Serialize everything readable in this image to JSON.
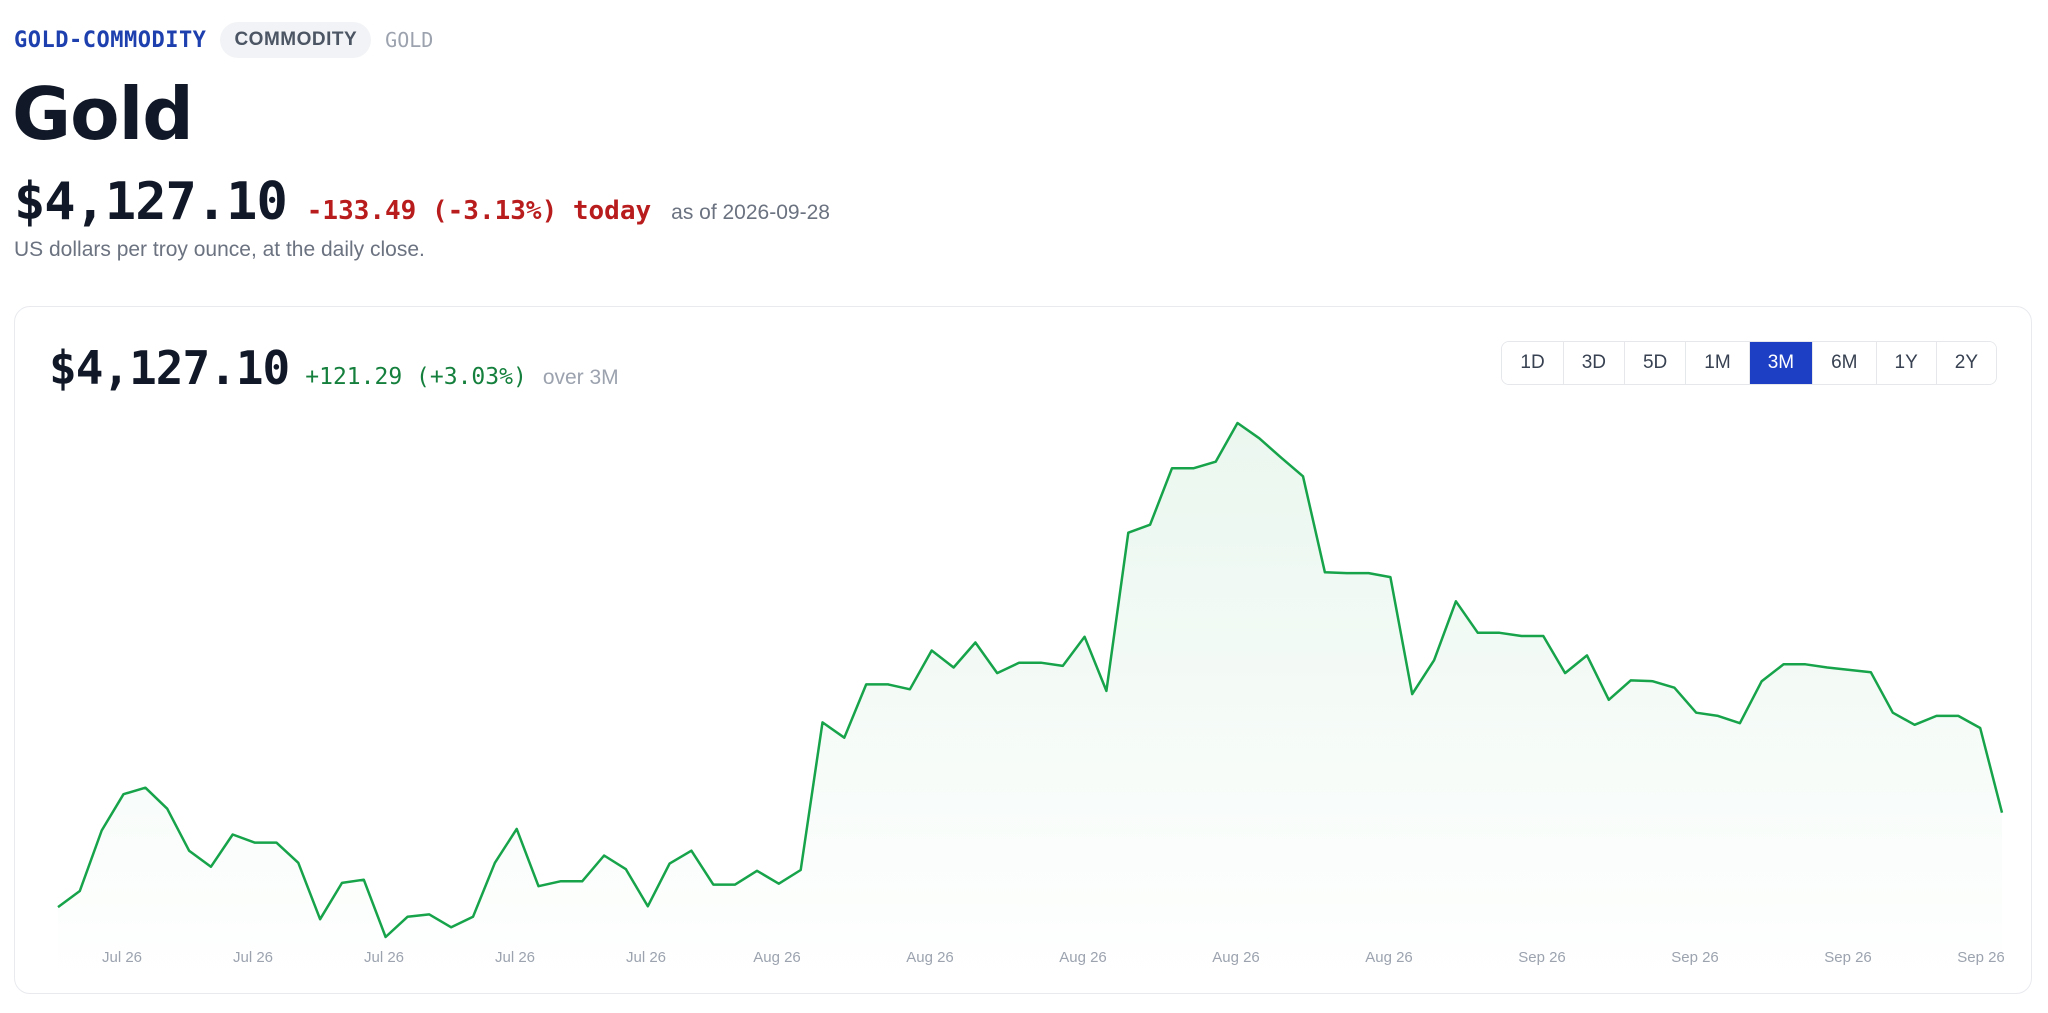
{
  "header": {
    "symbol": "GOLD-COMMODITY",
    "category": "COMMODITY",
    "ticker": "GOLD",
    "title": "Gold",
    "price": "$4,127.10",
    "change_today": "-133.49 (-3.13%) today",
    "as_of": "as of 2026-09-28",
    "subtitle": "US dollars per troy ounce, at the daily close."
  },
  "card": {
    "price": "$4,127.10",
    "change": "+121.29 (+3.03%)",
    "period": "over 3M"
  },
  "ranges": [
    "1D",
    "3D",
    "5D",
    "1M",
    "3M",
    "6M",
    "1Y",
    "2Y"
  ],
  "active_range": "3M",
  "colors": {
    "line": "#16a34a",
    "positive": "#15803d",
    "negative": "#b91c1c",
    "accent": "#1d3fc4"
  },
  "chart_data": {
    "type": "area",
    "x_tick_labels": [
      "Jul 26",
      "Jul 26",
      "Jul 26",
      "Jul 26",
      "Jul 26",
      "Aug 26",
      "Aug 26",
      "Aug 26",
      "Aug 26",
      "Aug 26",
      "Sep 26",
      "Sep 26",
      "Sep 26",
      "Sep 26"
    ],
    "series": [
      {
        "values": [
          3890,
          3910,
          3985,
          4030,
          4038,
          4012,
          3960,
          3940,
          3980,
          3970,
          3970,
          3945,
          3875,
          3920,
          3924,
          3853,
          3878,
          3881,
          3865,
          3878,
          3945,
          3987,
          3916,
          3922,
          3922,
          3954,
          3937,
          3891,
          3944,
          3960,
          3918,
          3918,
          3935,
          3919,
          3936,
          4119,
          4100,
          4166,
          4166,
          4160,
          4208,
          4187,
          4218,
          4180,
          4193,
          4193,
          4189,
          4225,
          4158,
          4354,
          4364,
          4434,
          4434,
          4442,
          4490,
          4471,
          4447,
          4424,
          4305,
          4304,
          4304,
          4299,
          4154,
          4196,
          4269,
          4230,
          4230,
          4226,
          4226,
          4180,
          4202,
          4147,
          4171,
          4170,
          4162,
          4131,
          4127,
          4118,
          4170,
          4191,
          4191,
          4187,
          4184,
          4181,
          4131,
          4116,
          4127,
          4127,
          4112,
          4007
        ]
      }
    ],
    "xlabel": "",
    "ylabel": "",
    "legend": "none",
    "grid": false
  }
}
